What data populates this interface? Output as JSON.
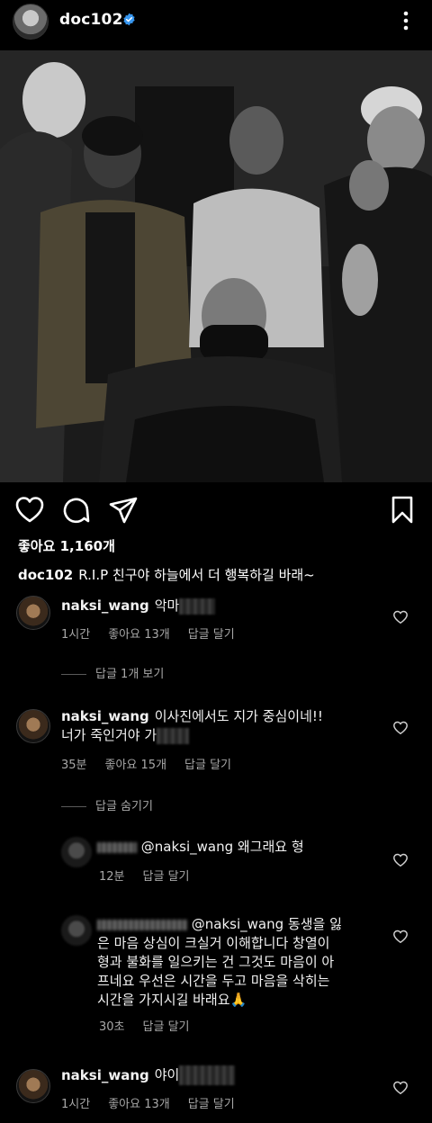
{
  "post": {
    "username": "doc102",
    "likes": "좋아요 1,160개",
    "caption_user": "doc102",
    "caption_text": "R.I.P 친구야 하늘에서 더 행복하길 바래~"
  },
  "comments": [
    {
      "user": "naksi_wang",
      "text": "악마",
      "time": "1시간",
      "likes": "좋아요 13개",
      "reply": "답글 달기",
      "thread": "답글 1개 보기"
    },
    {
      "user": "naksi_wang",
      "text_line1": "이사진에서도 지가 중심이네!!",
      "text_line2": "너가 죽인거야 가",
      "time": "35분",
      "likes": "좋아요 15개",
      "reply": "답글 달기",
      "thread": "답글 숨기기"
    },
    {
      "user": "naksi_wang",
      "text": "야이",
      "time": "1시간",
      "likes": "좋아요 13개",
      "reply": "답글 달기"
    }
  ],
  "replies": [
    {
      "text": "@naksi_wang 왜그래요 형",
      "time": "12분",
      "reply": "답글 달기"
    },
    {
      "line1": "@naksi_wang 동생을 잃",
      "line2": "은 마음 상심이 크실거 이해합니다 창열이",
      "line3": "형과 불화를 일으키는 건 그것도 마음이 아",
      "line4": "프네요 우선은 시간을 두고 마음을 삭히는",
      "line5": "시간을 가지시길 바래요🙏",
      "time": "30초",
      "reply": "답글 달기"
    }
  ],
  "icons": {
    "verified": "verified-badge-icon",
    "more": "more-options-icon",
    "like": "heart-icon",
    "comment": "comment-icon",
    "share": "send-icon",
    "save": "bookmark-icon"
  },
  "colors": {
    "background": "#000000",
    "verified": "#3897f0",
    "meta": "#a8a8a8"
  }
}
